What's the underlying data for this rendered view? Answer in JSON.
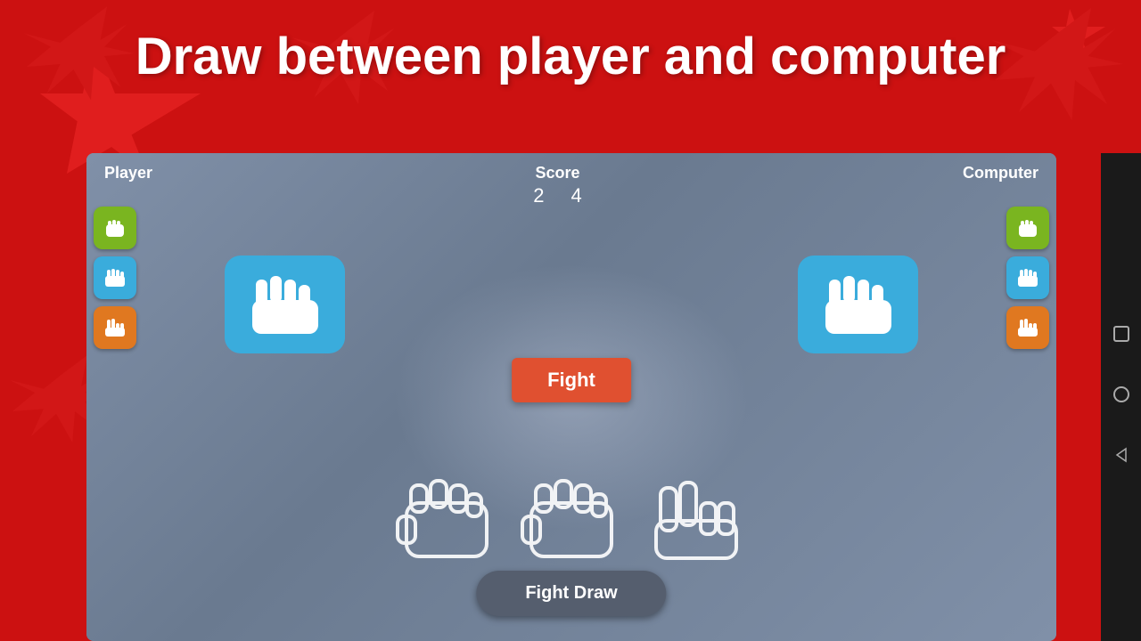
{
  "background": {
    "color": "#cc1111"
  },
  "title": "Draw between player and computer",
  "game": {
    "player_label": "Player",
    "computer_label": "Computer",
    "score_label": "Score",
    "player_score": "2",
    "computer_score": "4",
    "fight_button_label": "Fight",
    "fight_draw_button_label": "Fight Draw",
    "player_move": "paper",
    "computer_move": "paper",
    "left_icons": [
      {
        "type": "rock",
        "color": "green"
      },
      {
        "type": "paper",
        "color": "blue"
      },
      {
        "type": "scissors",
        "color": "orange"
      }
    ],
    "right_icons": [
      {
        "type": "rock",
        "color": "green"
      },
      {
        "type": "paper",
        "color": "blue"
      },
      {
        "type": "scissors",
        "color": "orange"
      }
    ]
  },
  "android_nav": {
    "square_btn": "□",
    "circle_btn": "○",
    "back_btn": "◁"
  },
  "icons": {
    "rock": "✊",
    "paper": "✋",
    "scissors": "✌"
  }
}
